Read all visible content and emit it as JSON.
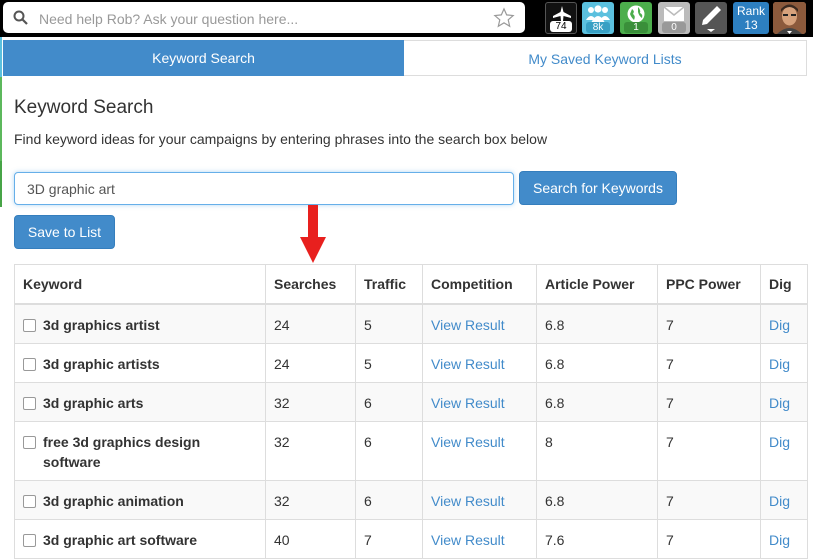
{
  "topbar": {
    "search_placeholder": "Need help Rob? Ask your question here...",
    "search_icon": "magnifier-icon",
    "favorite_icon": "star-icon",
    "buttons": [
      {
        "icon": "airplane-icon",
        "count": "74",
        "color": "#111111"
      },
      {
        "icon": "users-icon",
        "count": "8k",
        "color": "#5bc0de"
      },
      {
        "icon": "globe-icon",
        "count": "1",
        "color": "#4cae4c"
      },
      {
        "icon": "mail-icon",
        "count": "0",
        "color": "#bbbbbb"
      },
      {
        "icon": "pen-icon",
        "color": "#555555"
      }
    ],
    "rank": {
      "label": "Rank",
      "value": "13",
      "color": "#2d7fc0"
    },
    "avatar_icon": "user-avatar"
  },
  "tabs": [
    {
      "label": "Keyword Search",
      "active": true
    },
    {
      "label": "My Saved Keyword Lists",
      "active": false
    }
  ],
  "main": {
    "title": "Keyword Search",
    "description": "Find keyword ideas for your campaigns by entering phrases into the search box below",
    "keyword_input_value": "3D graphic art",
    "search_button": "Search for Keywords",
    "save_button": "Save to List",
    "accent_color": "#428bca",
    "annotation_arrow_color": "#e8201e"
  },
  "table": {
    "headers": [
      "Keyword",
      "Searches",
      "Traffic",
      "Competition",
      "Article Power",
      "PPC Power",
      "Dig"
    ],
    "rows": [
      {
        "keyword": "3d graphics artist",
        "searches": "24",
        "traffic": "5",
        "competition": "View Result",
        "article_power": "6.8",
        "ppc_power": "7",
        "dig": "Dig"
      },
      {
        "keyword": "3d graphic artists",
        "searches": "24",
        "traffic": "5",
        "competition": "View Result",
        "article_power": "6.8",
        "ppc_power": "7",
        "dig": "Dig"
      },
      {
        "keyword": "3d graphic arts",
        "searches": "32",
        "traffic": "6",
        "competition": "View Result",
        "article_power": "6.8",
        "ppc_power": "7",
        "dig": "Dig"
      },
      {
        "keyword": "free 3d graphics design software",
        "searches": "32",
        "traffic": "6",
        "competition": "View Result",
        "article_power": "8",
        "ppc_power": "7",
        "dig": "Dig"
      },
      {
        "keyword": "3d graphic animation",
        "searches": "32",
        "traffic": "6",
        "competition": "View Result",
        "article_power": "6.8",
        "ppc_power": "7",
        "dig": "Dig"
      },
      {
        "keyword": "3d graphic art software",
        "searches": "40",
        "traffic": "7",
        "competition": "View Result",
        "article_power": "7.6",
        "ppc_power": "7",
        "dig": "Dig"
      }
    ]
  }
}
